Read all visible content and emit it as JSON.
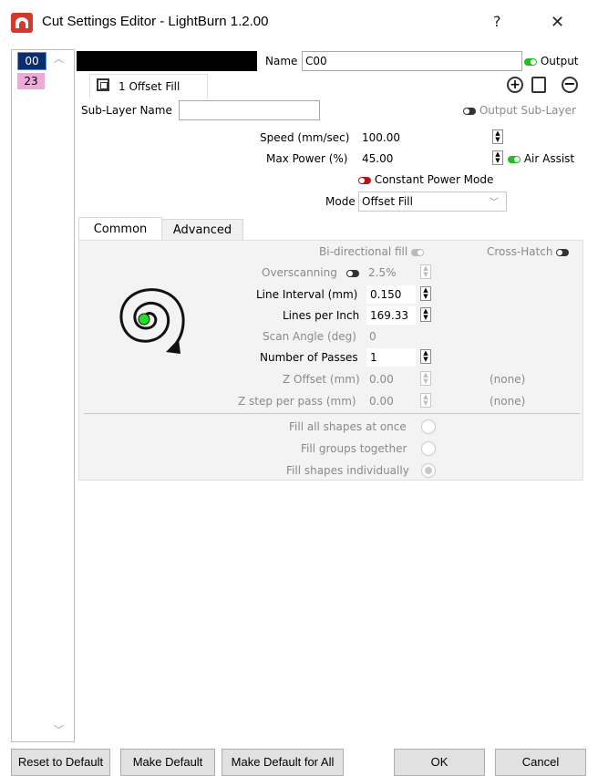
{
  "window": {
    "title": "Cut Settings Editor - LightBurn 1.2.00",
    "help_glyph": "?",
    "close_glyph": "✕",
    "app_icon": "lightburn-logo"
  },
  "layers": {
    "items": [
      {
        "label": "00",
        "color": "#000000"
      },
      {
        "label": "23",
        "color": "#f0a8d8"
      }
    ]
  },
  "header": {
    "layer_color": "#000000",
    "name_label": "Name",
    "name_value": "C00",
    "output_label": "Output",
    "output_on": true
  },
  "sublayer": {
    "tab_label": "1 Offset Fill",
    "name_label": "Sub-Layer Name",
    "name_value": "",
    "output_label": "Output Sub-Layer",
    "add_icon": "plus-circle-icon",
    "copy_icon": "copy-icon",
    "remove_icon": "minus-circle-icon"
  },
  "settings": {
    "speed_label": "Speed (mm/sec)",
    "speed_value": "100.00",
    "power_label": "Max Power (%)",
    "power_value": "45.00",
    "air_assist_label": "Air Assist",
    "constant_power_label": "Constant Power Mode",
    "mode_label": "Mode",
    "mode_value": "Offset Fill"
  },
  "tabs": [
    {
      "label": "Common",
      "active": true
    },
    {
      "label": "Advanced",
      "active": false
    }
  ],
  "common": {
    "bidirectional_label": "Bi-directional fill",
    "crosshatch_label": "Cross-Hatch",
    "overscanning_label": "Overscanning",
    "overscanning_value": "2.5%",
    "line_interval_label": "Line Interval (mm)",
    "line_interval_value": "0.150",
    "lpi_label": "Lines per Inch",
    "lpi_value": "169.33",
    "scan_angle_label": "Scan Angle (deg)",
    "scan_angle_value": "0",
    "passes_label": "Number of Passes",
    "passes_value": "1",
    "z_offset_label": "Z Offset (mm)",
    "z_offset_value": "0.00",
    "z_offset_extra": "(none)",
    "z_step_label": "Z step per pass (mm)",
    "z_step_value": "0.00",
    "z_step_extra": "(none)",
    "fill_all_label": "Fill all shapes at once",
    "fill_groups_label": "Fill groups together",
    "fill_individual_label": "Fill shapes individually"
  },
  "footer": {
    "reset_label": "Reset to Default",
    "make_default_label": "Make Default",
    "make_default_all_label": "Make Default for All",
    "ok_label": "OK",
    "cancel_label": "Cancel"
  }
}
